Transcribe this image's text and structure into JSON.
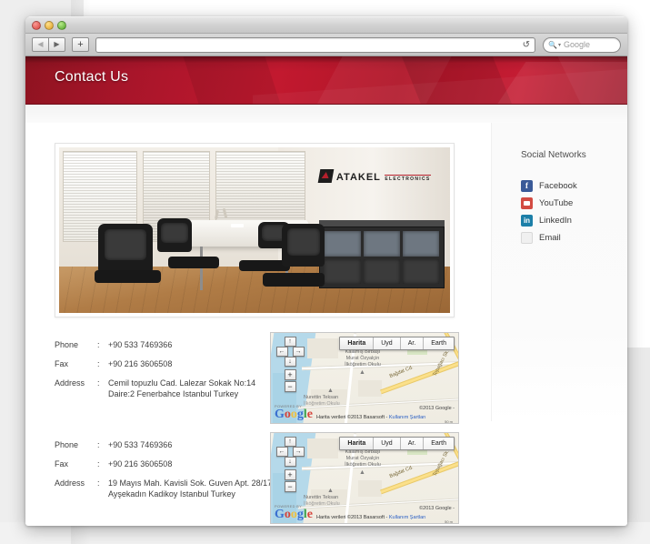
{
  "browser": {
    "back_icon": "back-arrow-icon",
    "forward_icon": "forward-arrow-icon",
    "add_tab_label": "+",
    "url_value": "",
    "url_placeholder": "",
    "reload_icon": "reload-icon",
    "search_placeholder": "Google",
    "search_icon": "search-magnifier-icon",
    "search_value": ""
  },
  "site": {
    "title": "Contact Us"
  },
  "photo": {
    "logo_primary": "ATAKEL",
    "logo_secondary": "ELECTRONICS",
    "alt": "office-meeting-room-photo"
  },
  "sidebar": {
    "title": "Social Networks",
    "items": [
      {
        "label": "Facebook",
        "icon": "facebook-icon",
        "glyph": "f"
      },
      {
        "label": "YouTube",
        "icon": "youtube-icon",
        "glyph": ""
      },
      {
        "label": "LinkedIn",
        "icon": "linkedin-icon",
        "glyph": "in"
      },
      {
        "label": "Email",
        "icon": "email-icon",
        "glyph": ""
      }
    ]
  },
  "contacts": [
    {
      "phone_label": "Phone",
      "fax_label": "Fax",
      "address_label": "Address",
      "colon": ":",
      "phone": "+90 533 7469366",
      "fax": "+90 216 3606508",
      "address_line1": "Cemil topuzlu Cad. Lalezar Sokak No:14",
      "address_line2": "Daire:2 Fenerbahce Istanbul Turkey"
    },
    {
      "phone_label": "Phone",
      "fax_label": "Fax",
      "address_label": "Address",
      "colon": ":",
      "phone": "+90 533 7469366",
      "fax": "+90 216 3606508",
      "address_line1": "19 Mayıs Mah. Kavisli Sok. Guven Apt. 28/17",
      "address_line2": "Ayşekadın Kadikoy Istanbul Turkey"
    }
  ],
  "map": {
    "types": [
      "Harita",
      "Uyd",
      "Ar.",
      "Earth"
    ],
    "active_type": "Harita",
    "pan_up": "↑",
    "pan_left": "←",
    "pan_right": "→",
    "pan_down": "↓",
    "zoom_in": "+",
    "zoom_out": "−",
    "powered_by": "POWERED BY",
    "brand": "Google",
    "credit": "©2013 Google -",
    "terms_prefix": "Harita verileri ©2013 Basarsoft - ",
    "terms_link": "Kullanım Şartları",
    "scale": "50 m",
    "labels": [
      "Kalamış Birbaşı",
      "Murat Özyalçin",
      "İlköğretim Okulu",
      "Nurettin Teksan",
      "İlköğretim Okulu"
    ],
    "roads": [
      "Bağdat Cd.",
      "Topağacı Sk."
    ]
  }
}
